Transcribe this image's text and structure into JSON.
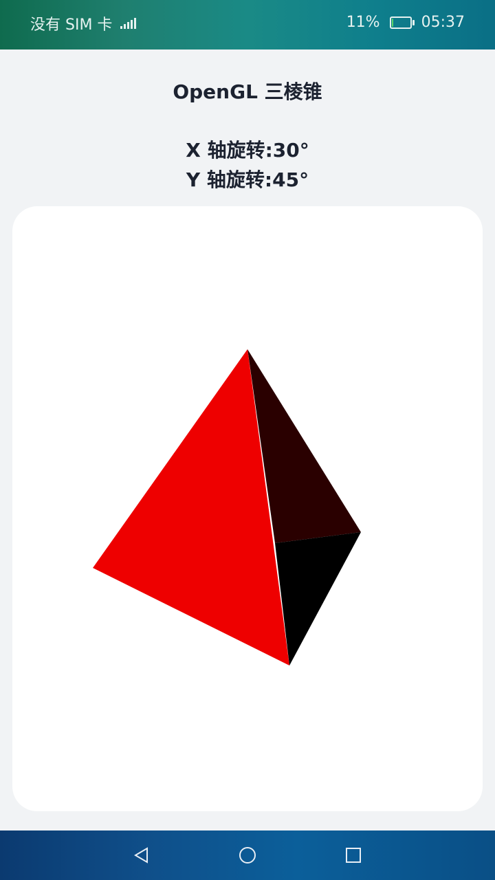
{
  "status_bar": {
    "carrier": "没有 SIM 卡",
    "battery_percent_text": "11%",
    "battery_level": 0.11,
    "time": "05:37",
    "icons": [
      "signal-icon",
      "battery-icon"
    ]
  },
  "header": {
    "title": "OpenGL 三棱锥"
  },
  "rotation": {
    "x_text": "X 轴旋转:30°",
    "y_text": "Y 轴旋转:45°"
  },
  "scene": {
    "object": "triangular-pyramid",
    "colors": {
      "front_face": "#ee0000",
      "right_face": "#2a0000",
      "bottom_face": "#000000",
      "card_background": "#ffffff"
    }
  },
  "nav_bar": {
    "buttons": [
      "back-icon",
      "home-icon",
      "recents-icon"
    ]
  }
}
